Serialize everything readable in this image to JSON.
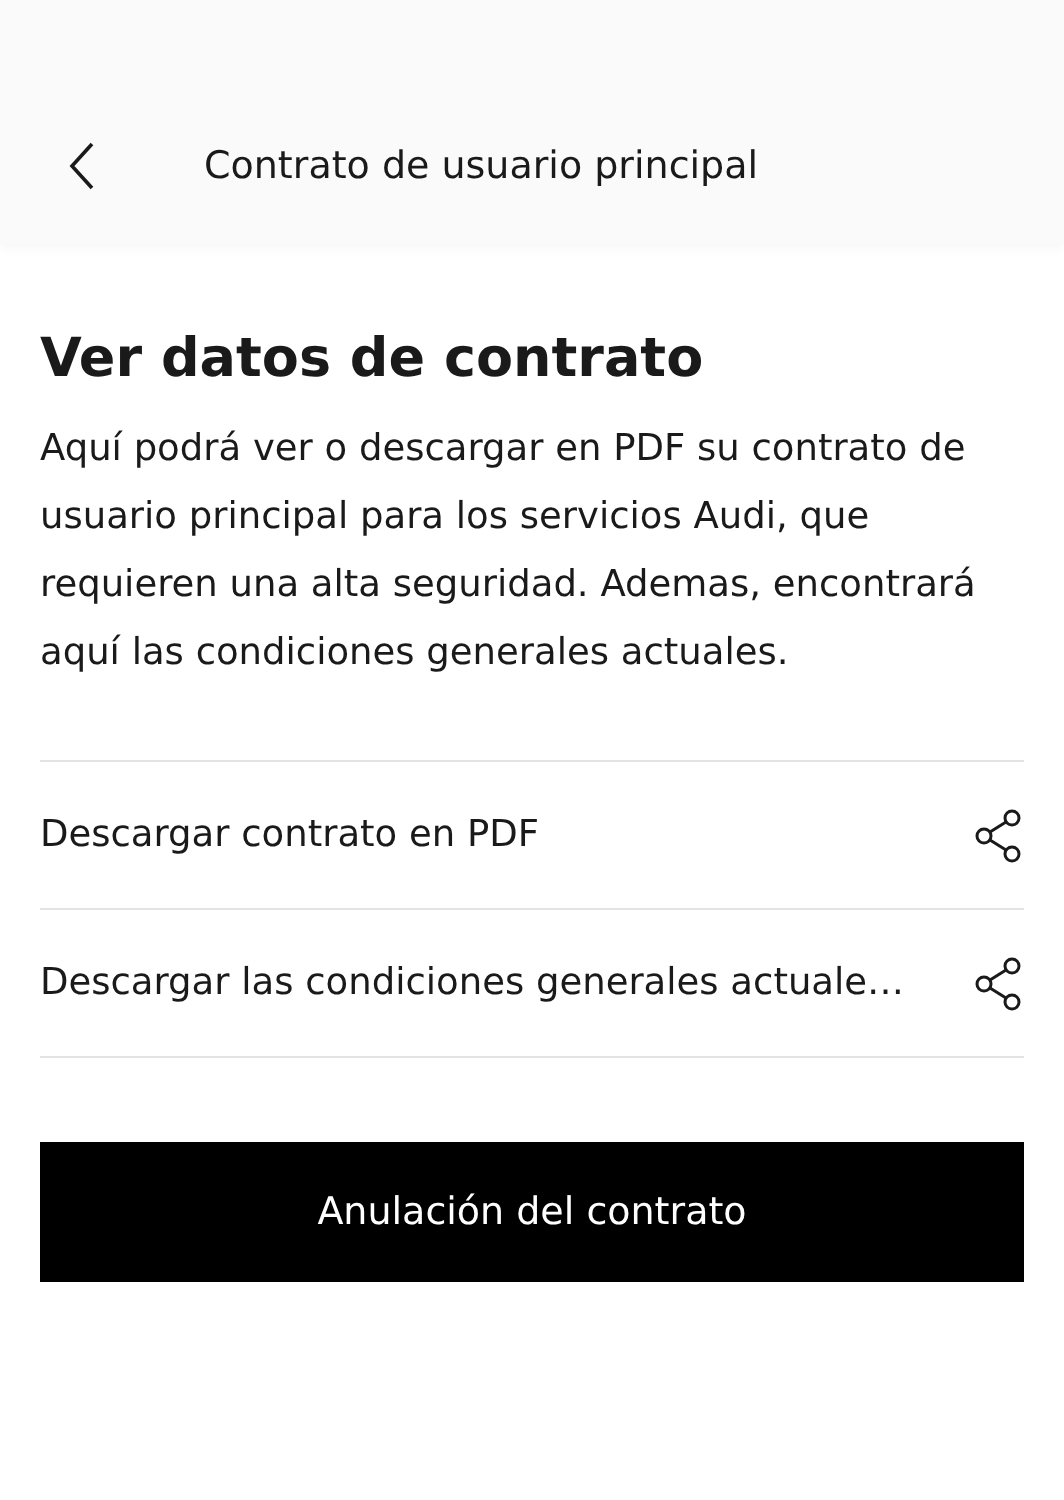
{
  "header": {
    "title": "Contrato de usuario principal"
  },
  "heading": "Ver datos de contrato",
  "description": "Aquí podrá ver o descargar en PDF su contrato de usuario principal para los servicios Audi, que requieren una alta seguridad. Ademas, encontrará aquí las condiciones generales actuales.",
  "rows": [
    {
      "label": "Descargar contrato en PDF"
    },
    {
      "label": "Descargar las condiciones generales actuale…"
    }
  ],
  "button": "Anulación del contrato"
}
